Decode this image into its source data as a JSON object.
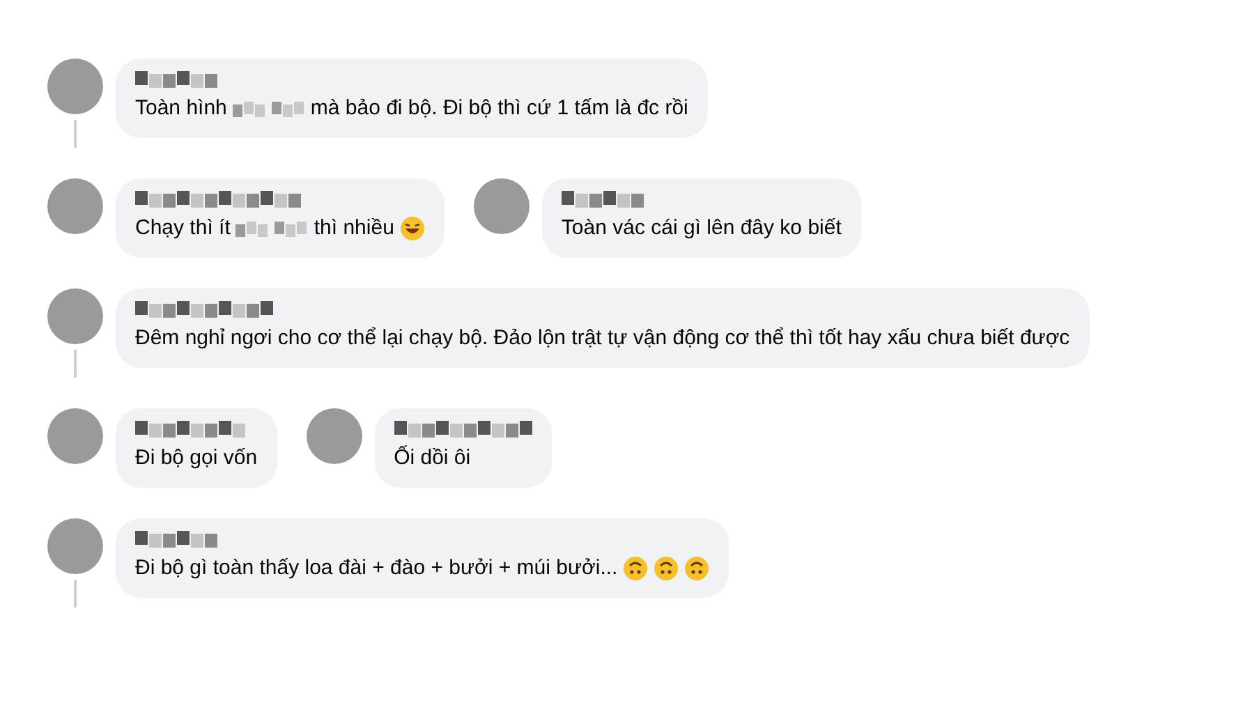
{
  "threads": [
    {
      "comments": [
        {
          "thread_line": true,
          "body": [
            {
              "kind": "text",
              "text": "Toàn hình"
            },
            {
              "kind": "blur"
            },
            {
              "kind": "text",
              "text": "mà bảo đi bộ. Đi bộ thì cứ 1 tấm là đc rồi"
            }
          ]
        }
      ]
    },
    {
      "comments": [
        {
          "thread_line": false,
          "body": [
            {
              "kind": "text",
              "text": "Chạy thì ít"
            },
            {
              "kind": "blur"
            },
            {
              "kind": "text",
              "text": "thì nhiều"
            },
            {
              "kind": "laughing-icon"
            }
          ]
        },
        {
          "thread_line": false,
          "body": [
            {
              "kind": "text",
              "text": "Toàn vác cái gì lên đây ko biết"
            }
          ]
        }
      ]
    },
    {
      "comments": [
        {
          "thread_line": true,
          "body": [
            {
              "kind": "text",
              "text": "Đêm nghỉ ngơi cho cơ thể lại chạy bộ. Đảo lộn trật tự vận động cơ thể thì tốt hay xấu chưa biết được"
            }
          ]
        }
      ]
    },
    {
      "comments": [
        {
          "thread_line": false,
          "body": [
            {
              "kind": "text",
              "text": "Đi bộ gọi vốn"
            }
          ]
        },
        {
          "thread_line": false,
          "body": [
            {
              "kind": "text",
              "text": "Ối dồi ôi"
            }
          ]
        }
      ]
    },
    {
      "comments": [
        {
          "thread_line": true,
          "body": [
            {
              "kind": "text",
              "text": "Đi bộ gì toàn thấy loa đài + đào + bưởi + múi bưởi..."
            },
            {
              "kind": "upside-down-icon"
            },
            {
              "kind": "upside-down-icon"
            },
            {
              "kind": "upside-down-icon"
            }
          ]
        }
      ]
    }
  ]
}
